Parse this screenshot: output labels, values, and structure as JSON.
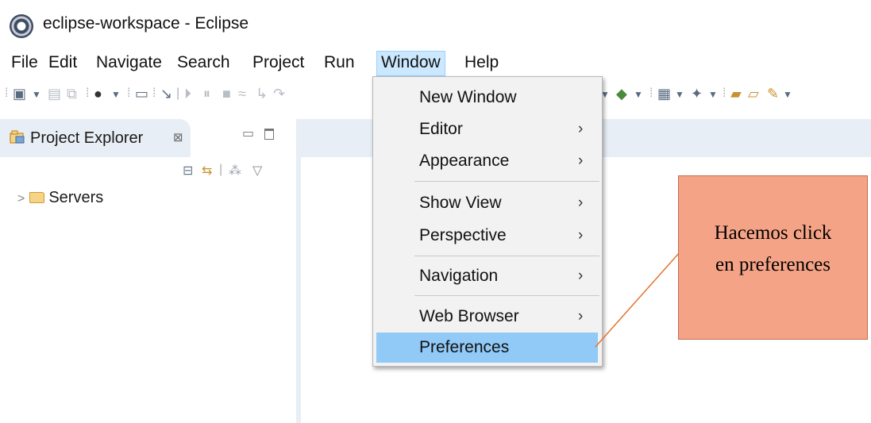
{
  "window": {
    "title": "eclipse-workspace - Eclipse"
  },
  "menubar": {
    "items": [
      "File",
      "Edit",
      "Navigate",
      "Search",
      "Project",
      "Run",
      "Window",
      "Help"
    ],
    "active": "Window"
  },
  "toolbar": {
    "icons": [
      "new-icon",
      "save-icon",
      "save-all-icon",
      "run-icon",
      "console-icon",
      "breakpoint-icon",
      "resume-icon",
      "suspend-icon",
      "terminate-icon",
      "disconnect-icon",
      "step-into-icon",
      "step-over-icon",
      "debug-icon",
      "new-server-icon",
      "new-project-icon",
      "open-folder-icon",
      "open-perspective-icon",
      "pin-icon"
    ]
  },
  "explorer": {
    "title": "Project Explorer",
    "close_glyph": "⊠",
    "tree": [
      {
        "label": "Servers",
        "expanded": false
      }
    ]
  },
  "window_menu": {
    "items": [
      {
        "label": "New Window",
        "submenu": false
      },
      {
        "label": "Editor",
        "submenu": true
      },
      {
        "label": "Appearance",
        "submenu": true
      },
      {
        "label": "Show View",
        "submenu": true
      },
      {
        "label": "Perspective",
        "submenu": true
      },
      {
        "label": "Navigation",
        "submenu": true
      },
      {
        "label": "Web Browser",
        "submenu": true
      },
      {
        "label": "Preferences",
        "submenu": false,
        "highlighted": true
      }
    ],
    "arrow_glyph": "›"
  },
  "callout": {
    "line1": "Hacemos click",
    "line2": "en preferences"
  },
  "colors": {
    "menu_highlight": "#91c9f7",
    "menubar_active": "#cce8ff",
    "callout_fill": "#f5a386",
    "pointer_line": "#e3742d",
    "panel": "#e8eef5"
  }
}
